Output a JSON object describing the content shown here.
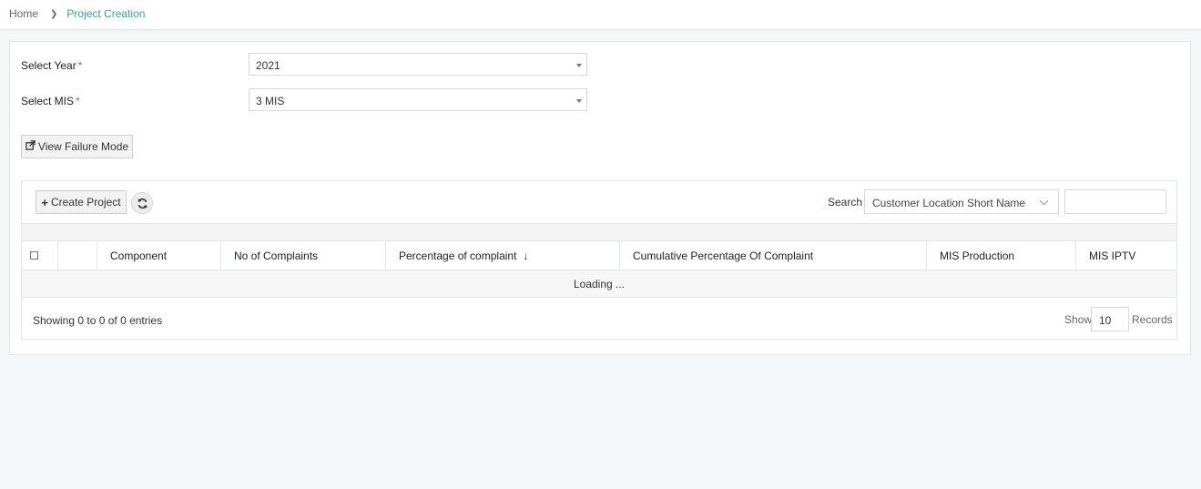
{
  "breadcrumb": {
    "home": "Home",
    "separator_icon": "chevron-right",
    "current": "Project Creation"
  },
  "form": {
    "year_label": "Select Year",
    "year_value": "2021",
    "mis_label": "Select MIS",
    "mis_value": "3 MIS",
    "required_mark": "*"
  },
  "actions": {
    "view_failure_mode": "View Failure Mode",
    "view_failure_icon": "external-link-icon",
    "create_project": "Create Project",
    "create_icon": "plus-icon",
    "refresh_icon": "refresh-icon"
  },
  "search": {
    "label": "Search",
    "field_value": "Customer Location Short Name",
    "input_value": ""
  },
  "table": {
    "columns": [
      "",
      "",
      "Component",
      "No of Complaints",
      "Percentage of complaint",
      "Cumulative Percentage Of Complaint",
      "MIS Production",
      "MIS IPTV"
    ],
    "sorted_column_icon": "sort-desc-icon",
    "loading_text": "Loading ..."
  },
  "pagination": {
    "showing_text": "Showing 0 to 0 of 0 entries",
    "show_label": "Show",
    "page_size": "10",
    "records_label": "Records"
  },
  "colors": {
    "accent": "#3aa391",
    "required": "#d9534f",
    "panel_bg": "#ffffff",
    "page_bg": "#f4f6f8"
  }
}
